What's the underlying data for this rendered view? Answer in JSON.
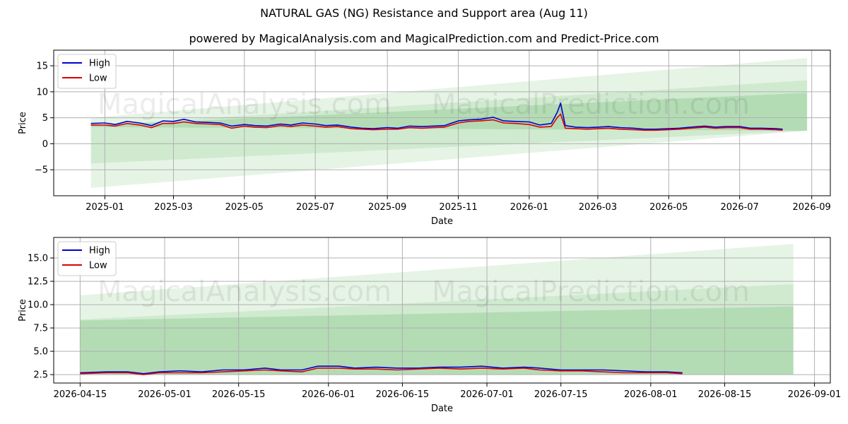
{
  "title": "NATURAL GAS (NG) Resistance and Support area (Aug 11)",
  "subtitle": "powered by MagicalAnalysis.com and MagicalPrediction.com and Predict-Price.com",
  "watermarks": [
    "MagicalAnalysis.com",
    "MagicalPrediction.com"
  ],
  "colors": {
    "high": "#0000cc",
    "low": "#dd0000",
    "band": "#4caf50",
    "grid": "#b0b0b0"
  },
  "chart_data": [
    {
      "type": "line",
      "xlabel": "Date",
      "ylabel": "Price",
      "x_ticks": [
        "2025-01",
        "2025-03",
        "2025-05",
        "2025-07",
        "2025-09",
        "2025-11",
        "2026-01",
        "2026-03",
        "2026-05",
        "2026-07",
        "2026-09"
      ],
      "x_tick_dates": [
        "2025-01-01",
        "2025-03-01",
        "2025-05-01",
        "2025-07-01",
        "2025-09-01",
        "2025-11-01",
        "2026-01-01",
        "2026-03-01",
        "2026-05-01",
        "2026-07-01",
        "2026-09-01"
      ],
      "xlim": [
        "2024-11-18",
        "2026-09-17"
      ],
      "y_ticks": [
        -5,
        0,
        5,
        10,
        15
      ],
      "ylim": [
        -10.0,
        18.0
      ],
      "grid": true,
      "legend": "top-left",
      "bands": [
        {
          "x": [
            "2024-12-20",
            "2026-08-28"
          ],
          "lower": [
            -8.5,
            2.5
          ],
          "upper": [
            5.0,
            16.5
          ],
          "opacity": 0.14
        },
        {
          "x": [
            "2024-12-20",
            "2026-08-28"
          ],
          "lower": [
            -3.8,
            2.5
          ],
          "upper": [
            3.5,
            12.2
          ],
          "opacity": 0.14
        },
        {
          "x": [
            "2024-12-20",
            "2026-08-28"
          ],
          "lower": [
            3.2,
            2.5
          ],
          "upper": [
            3.5,
            9.8
          ],
          "opacity": 0.22
        }
      ],
      "series": [
        {
          "name": "High",
          "x": [
            "2024-12-20",
            "2025-01-01",
            "2025-01-10",
            "2025-01-20",
            "2025-01-31",
            "2025-02-10",
            "2025-02-20",
            "2025-03-01",
            "2025-03-10",
            "2025-03-20",
            "2025-04-01",
            "2025-04-10",
            "2025-04-20",
            "2025-05-01",
            "2025-05-10",
            "2025-05-20",
            "2025-06-01",
            "2025-06-10",
            "2025-06-20",
            "2025-07-01",
            "2025-07-10",
            "2025-07-20",
            "2025-08-01",
            "2025-08-10",
            "2025-08-20",
            "2025-09-01",
            "2025-09-10",
            "2025-09-20",
            "2025-10-01",
            "2025-10-10",
            "2025-10-20",
            "2025-11-01",
            "2025-11-10",
            "2025-11-20",
            "2025-12-01",
            "2025-12-10",
            "2025-12-20",
            "2026-01-01",
            "2026-01-10",
            "2026-01-20",
            "2026-01-25",
            "2026-01-28",
            "2026-02-01",
            "2026-02-10",
            "2026-02-20",
            "2026-03-01",
            "2026-03-10",
            "2026-03-20",
            "2026-04-01",
            "2026-04-10",
            "2026-04-20",
            "2026-05-01",
            "2026-05-10",
            "2026-05-20",
            "2026-06-01",
            "2026-06-10",
            "2026-06-20",
            "2026-07-01",
            "2026-07-10",
            "2026-07-20",
            "2026-08-01",
            "2026-08-07"
          ],
          "y": [
            3.9,
            4.0,
            3.7,
            4.3,
            4.0,
            3.5,
            4.4,
            4.3,
            4.7,
            4.2,
            4.1,
            4.0,
            3.4,
            3.7,
            3.5,
            3.4,
            3.8,
            3.6,
            4.0,
            3.8,
            3.5,
            3.6,
            3.2,
            3.0,
            2.9,
            3.1,
            3.0,
            3.4,
            3.3,
            3.4,
            3.5,
            4.4,
            4.6,
            4.7,
            5.1,
            4.4,
            4.3,
            4.2,
            3.6,
            3.9,
            6.0,
            7.8,
            3.5,
            3.2,
            3.1,
            3.2,
            3.3,
            3.1,
            3.0,
            2.8,
            2.8,
            2.9,
            3.0,
            3.2,
            3.4,
            3.2,
            3.3,
            3.3,
            3.0,
            3.0,
            2.9,
            2.8
          ]
        },
        {
          "name": "Low",
          "x": [
            "2024-12-20",
            "2025-01-01",
            "2025-01-10",
            "2025-01-20",
            "2025-01-31",
            "2025-02-10",
            "2025-02-20",
            "2025-03-01",
            "2025-03-10",
            "2025-03-20",
            "2025-04-01",
            "2025-04-10",
            "2025-04-20",
            "2025-05-01",
            "2025-05-10",
            "2025-05-20",
            "2025-06-01",
            "2025-06-10",
            "2025-06-20",
            "2025-07-01",
            "2025-07-10",
            "2025-07-20",
            "2025-08-01",
            "2025-08-10",
            "2025-08-20",
            "2025-09-01",
            "2025-09-10",
            "2025-09-20",
            "2025-10-01",
            "2025-10-10",
            "2025-10-20",
            "2025-11-01",
            "2025-11-10",
            "2025-11-20",
            "2025-12-01",
            "2025-12-10",
            "2025-12-20",
            "2026-01-01",
            "2026-01-10",
            "2026-01-20",
            "2026-01-25",
            "2026-01-28",
            "2026-02-01",
            "2026-02-10",
            "2026-02-20",
            "2026-03-01",
            "2026-03-10",
            "2026-03-20",
            "2026-04-01",
            "2026-04-10",
            "2026-04-20",
            "2026-05-01",
            "2026-05-10",
            "2026-05-20",
            "2026-06-01",
            "2026-06-10",
            "2026-06-20",
            "2026-07-01",
            "2026-07-10",
            "2026-07-20",
            "2026-08-01",
            "2026-08-07"
          ],
          "y": [
            3.6,
            3.6,
            3.4,
            3.9,
            3.6,
            3.1,
            3.9,
            3.9,
            4.2,
            3.9,
            3.8,
            3.7,
            3.0,
            3.4,
            3.2,
            3.1,
            3.5,
            3.3,
            3.6,
            3.4,
            3.2,
            3.3,
            2.9,
            2.8,
            2.7,
            2.8,
            2.8,
            3.1,
            3.0,
            3.1,
            3.2,
            4.0,
            4.3,
            4.4,
            4.6,
            4.0,
            3.9,
            3.7,
            3.2,
            3.3,
            5.0,
            5.7,
            3.0,
            2.9,
            2.8,
            2.9,
            3.0,
            2.8,
            2.7,
            2.6,
            2.6,
            2.7,
            2.8,
            3.0,
            3.2,
            3.0,
            3.1,
            3.1,
            2.8,
            2.8,
            2.7,
            2.6
          ]
        }
      ]
    },
    {
      "type": "line",
      "xlabel": "Date",
      "ylabel": "Price",
      "x_ticks": [
        "2026-04-15",
        "2026-05-01",
        "2026-05-15",
        "2026-06-01",
        "2026-06-15",
        "2026-07-01",
        "2026-07-15",
        "2026-08-01",
        "2026-08-15",
        "2026-09-01"
      ],
      "x_tick_dates": [
        "2026-04-15",
        "2026-05-01",
        "2026-05-15",
        "2026-06-01",
        "2026-06-15",
        "2026-07-01",
        "2026-07-15",
        "2026-08-01",
        "2026-08-15",
        "2026-09-01"
      ],
      "xlim": [
        "2026-04-10",
        "2026-09-04"
      ],
      "y_ticks": [
        2.5,
        5.0,
        7.5,
        10.0,
        12.5,
        15.0
      ],
      "y_tick_labels": [
        "2.5",
        "5.0",
        "7.5",
        "10.0",
        "12.5",
        "15.0"
      ],
      "ylim": [
        1.6,
        17.2
      ],
      "grid": true,
      "legend": "top-left",
      "bands": [
        {
          "x": [
            "2026-04-15",
            "2026-08-28"
          ],
          "lower": [
            2.5,
            2.5
          ],
          "upper": [
            11.0,
            16.5
          ],
          "opacity": 0.14
        },
        {
          "x": [
            "2026-04-15",
            "2026-08-28"
          ],
          "lower": [
            2.5,
            2.5
          ],
          "upper": [
            8.4,
            12.2
          ],
          "opacity": 0.14
        },
        {
          "x": [
            "2026-04-15",
            "2026-08-28"
          ],
          "lower": [
            2.5,
            2.5
          ],
          "upper": [
            8.3,
            9.8
          ],
          "opacity": 0.22
        }
      ],
      "series": [
        {
          "name": "High",
          "x": [
            "2026-04-15",
            "2026-04-20",
            "2026-04-24",
            "2026-04-27",
            "2026-04-30",
            "2026-05-04",
            "2026-05-08",
            "2026-05-12",
            "2026-05-16",
            "2026-05-20",
            "2026-05-23",
            "2026-05-27",
            "2026-05-30",
            "2026-06-03",
            "2026-06-06",
            "2026-06-10",
            "2026-06-14",
            "2026-06-18",
            "2026-06-22",
            "2026-06-26",
            "2026-06-30",
            "2026-07-04",
            "2026-07-08",
            "2026-07-11",
            "2026-07-15",
            "2026-07-19",
            "2026-07-23",
            "2026-07-27",
            "2026-07-31",
            "2026-08-04",
            "2026-08-07"
          ],
          "y": [
            2.7,
            2.8,
            2.8,
            2.6,
            2.8,
            2.9,
            2.8,
            3.0,
            3.0,
            3.2,
            3.0,
            3.0,
            3.4,
            3.4,
            3.2,
            3.3,
            3.2,
            3.2,
            3.3,
            3.3,
            3.4,
            3.2,
            3.3,
            3.2,
            3.0,
            3.0,
            3.0,
            2.9,
            2.8,
            2.8,
            2.7
          ]
        },
        {
          "name": "Low",
          "x": [
            "2026-04-15",
            "2026-04-20",
            "2026-04-24",
            "2026-04-27",
            "2026-04-30",
            "2026-05-04",
            "2026-05-08",
            "2026-05-12",
            "2026-05-16",
            "2026-05-20",
            "2026-05-23",
            "2026-05-27",
            "2026-05-30",
            "2026-06-03",
            "2026-06-06",
            "2026-06-10",
            "2026-06-14",
            "2026-06-18",
            "2026-06-22",
            "2026-06-26",
            "2026-06-30",
            "2026-07-04",
            "2026-07-08",
            "2026-07-11",
            "2026-07-15",
            "2026-07-19",
            "2026-07-23",
            "2026-07-27",
            "2026-07-31",
            "2026-08-04",
            "2026-08-07"
          ],
          "y": [
            2.6,
            2.7,
            2.7,
            2.5,
            2.7,
            2.7,
            2.7,
            2.8,
            2.9,
            3.0,
            2.9,
            2.8,
            3.2,
            3.2,
            3.1,
            3.1,
            3.0,
            3.1,
            3.2,
            3.1,
            3.2,
            3.1,
            3.2,
            3.0,
            2.9,
            2.9,
            2.8,
            2.7,
            2.7,
            2.7,
            2.6
          ]
        }
      ]
    }
  ]
}
